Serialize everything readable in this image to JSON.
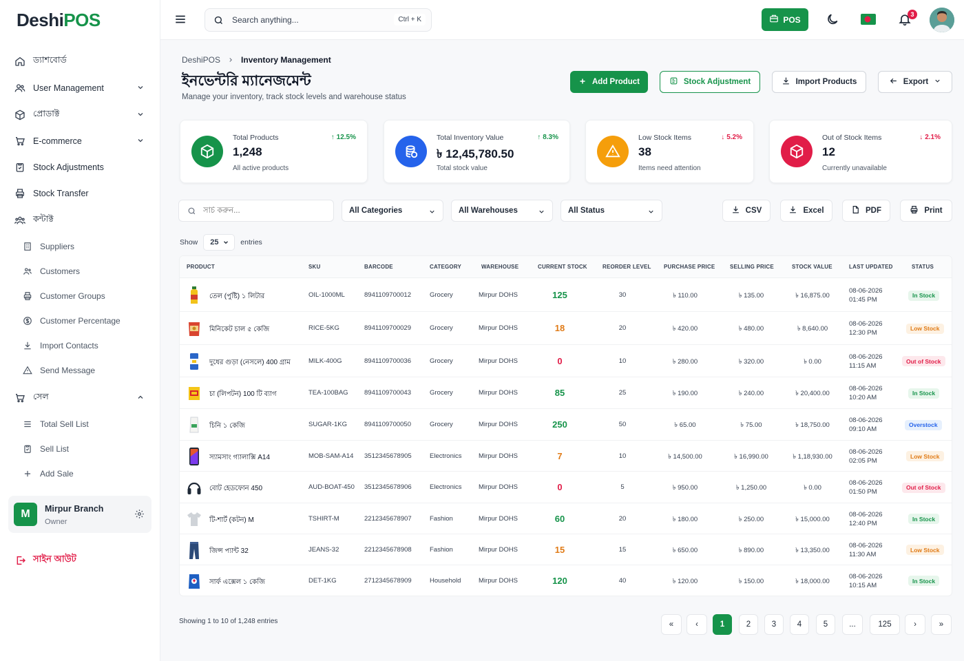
{
  "brand": {
    "prefix": "Deshi",
    "suffix": "POS"
  },
  "sidebar": {
    "items": [
      {
        "label": "ড্যাশবোর্ড",
        "icon": "home-icon"
      },
      {
        "label": "User Management",
        "icon": "users-icon"
      },
      {
        "label": "প্রোডাক্ট",
        "icon": "box-icon"
      },
      {
        "label": "E-commerce",
        "icon": "cart-icon"
      },
      {
        "label": "Stock Adjustments",
        "icon": "clipboard-icon"
      },
      {
        "label": "Stock Transfer",
        "icon": "printer-icon"
      },
      {
        "label": "কন্টাক্ট",
        "icon": "contacts-icon"
      },
      {
        "label": "সেল",
        "icon": "cart-icon"
      }
    ],
    "contact_sub": [
      "Suppliers",
      "Customers",
      "Customer Groups",
      "Customer Percentage",
      "Import Contacts",
      "Send Message"
    ],
    "sale_sub": [
      "Total Sell List",
      "Sell List",
      "Add Sale"
    ],
    "branch": {
      "initial": "M",
      "name": "Mirpur Branch",
      "role": "Owner"
    },
    "signout": "সাইন আউট"
  },
  "header": {
    "search_placeholder": "Search anything...",
    "shortcut": "Ctrl + K",
    "pos_label": "POS",
    "notification_count": "3"
  },
  "breadcrumb": {
    "root": "DeshiPOS",
    "current": "Inventory Management"
  },
  "page": {
    "title": "ইনভেন্টরি ম্যানেজমেন্ট",
    "subtitle": "Manage your inventory, track stock levels and warehouse status"
  },
  "actions": {
    "add": "Add Product",
    "adjust": "Stock Adjustment",
    "import": "Import Products",
    "export": "Export"
  },
  "stats": [
    {
      "label": "Total Products",
      "value": "1,248",
      "note": "All active products",
      "trend": "12.5%",
      "dir": "up",
      "color": "#16934a"
    },
    {
      "label": "Total Inventory Value",
      "value": "৳ 12,45,780.50",
      "note": "Total stock value",
      "trend": "8.3%",
      "dir": "up",
      "color": "#2563eb"
    },
    {
      "label": "Low Stock Items",
      "value": "38",
      "note": "Items need attention",
      "trend": "5.2%",
      "dir": "down",
      "color": "#f59e0b"
    },
    {
      "label": "Out of Stock Items",
      "value": "12",
      "note": "Currently unavailable",
      "trend": "2.1%",
      "dir": "down",
      "color": "#e11d48"
    }
  ],
  "filters": {
    "search_placeholder": "সার্চ করুন...",
    "category": "All Categories",
    "warehouse": "All Warehouses",
    "status": "All Status",
    "csv": "CSV",
    "excel": "Excel",
    "pdf": "PDF",
    "print": "Print"
  },
  "show": {
    "label": "Show",
    "value": "25",
    "suffix": "entries"
  },
  "table": {
    "headers": [
      "PRODUCT",
      "SKU",
      "BARCODE",
      "CATEGORY",
      "WAREHOUSE",
      "CURRENT STOCK",
      "REORDER LEVEL",
      "PURCHASE PRICE",
      "SELLING PRICE",
      "STOCK VALUE",
      "LAST UPDATED",
      "STATUS"
    ],
    "rows": [
      {
        "name": "তেল (পুষ্টি) ১ লিটার",
        "sku": "OIL-1000ML",
        "barcode": "8941109700012",
        "category": "Grocery",
        "warehouse": "Mirpur DOHS",
        "stock": "125",
        "reorder": "30",
        "purchase": "৳ 110.00",
        "selling": "৳ 135.00",
        "value": "৳ 16,875.00",
        "date": "08-06-2026",
        "time": "01:45 PM",
        "status": "In Stock",
        "st": "in",
        "icon": "oil-bottle-icon"
      },
      {
        "name": "মিনিকেট চাল ৫ কেজি",
        "sku": "RICE-5KG",
        "barcode": "8941109700029",
        "category": "Grocery",
        "warehouse": "Mirpur DOHS",
        "stock": "18",
        "reorder": "20",
        "purchase": "৳ 420.00",
        "selling": "৳ 480.00",
        "value": "৳ 8,640.00",
        "date": "08-06-2026",
        "time": "12:30 PM",
        "status": "Low Stock",
        "st": "low",
        "icon": "rice-bag-icon"
      },
      {
        "name": "দুধের গুড়া (নেসলে) 400 গ্রাম",
        "sku": "MILK-400G",
        "barcode": "8941109700036",
        "category": "Grocery",
        "warehouse": "Mirpur DOHS",
        "stock": "0",
        "reorder": "10",
        "purchase": "৳ 280.00",
        "selling": "৳ 320.00",
        "value": "৳ 0.00",
        "date": "08-06-2026",
        "time": "11:15 AM",
        "status": "Out of Stock",
        "st": "out",
        "icon": "milk-can-icon"
      },
      {
        "name": "চা (লিপটন) 100 টি ব্যাগ",
        "sku": "TEA-100BAG",
        "barcode": "8941109700043",
        "category": "Grocery",
        "warehouse": "Mirpur DOHS",
        "stock": "85",
        "reorder": "25",
        "purchase": "৳ 190.00",
        "selling": "৳ 240.00",
        "value": "৳ 20,400.00",
        "date": "08-06-2026",
        "time": "10:20 AM",
        "status": "In Stock",
        "st": "in",
        "icon": "tea-box-icon"
      },
      {
        "name": "চিনি ১ কেজি",
        "sku": "SUGAR-1KG",
        "barcode": "8941109700050",
        "category": "Grocery",
        "warehouse": "Mirpur DOHS",
        "stock": "250",
        "reorder": "50",
        "purchase": "৳ 65.00",
        "selling": "৳ 75.00",
        "value": "৳ 18,750.00",
        "date": "08-06-2026",
        "time": "09:10 AM",
        "status": "Overstock",
        "st": "over",
        "icon": "sugar-pack-icon"
      },
      {
        "name": "স্যামসাং গ্যালাক্সি A14",
        "sku": "MOB-SAM-A14",
        "barcode": "3512345678905",
        "category": "Electronics",
        "warehouse": "Mirpur DOHS",
        "stock": "7",
        "reorder": "10",
        "purchase": "৳ 14,500.00",
        "selling": "৳ 16,990.00",
        "value": "৳ 1,18,930.00",
        "date": "08-06-2026",
        "time": "02:05 PM",
        "status": "Low Stock",
        "st": "low",
        "icon": "phone-icon"
      },
      {
        "name": "বোট হেডফোন 450",
        "sku": "AUD-BOAT-450",
        "barcode": "3512345678906",
        "category": "Electronics",
        "warehouse": "Mirpur DOHS",
        "stock": "0",
        "reorder": "5",
        "purchase": "৳ 950.00",
        "selling": "৳ 1,250.00",
        "value": "৳ 0.00",
        "date": "08-06-2026",
        "time": "01:50 PM",
        "status": "Out of Stock",
        "st": "out",
        "icon": "headphone-icon"
      },
      {
        "name": "টি-শার্ট (কটন) M",
        "sku": "TSHIRT-M",
        "barcode": "2212345678907",
        "category": "Fashion",
        "warehouse": "Mirpur DOHS",
        "stock": "60",
        "reorder": "20",
        "purchase": "৳ 180.00",
        "selling": "৳ 250.00",
        "value": "৳ 15,000.00",
        "date": "08-06-2026",
        "time": "12:40 PM",
        "status": "In Stock",
        "st": "in",
        "icon": "tshirt-icon"
      },
      {
        "name": "জিন্স প্যান্ট 32",
        "sku": "JEANS-32",
        "barcode": "2212345678908",
        "category": "Fashion",
        "warehouse": "Mirpur DOHS",
        "stock": "15",
        "reorder": "15",
        "purchase": "৳ 650.00",
        "selling": "৳ 890.00",
        "value": "৳ 13,350.00",
        "date": "08-06-2026",
        "time": "11:30 AM",
        "status": "Low Stock",
        "st": "low",
        "icon": "jeans-icon"
      },
      {
        "name": "সার্ফ এক্সেল ১ কেজি",
        "sku": "DET-1KG",
        "barcode": "2712345678909",
        "category": "Household",
        "warehouse": "Mirpur DOHS",
        "stock": "120",
        "reorder": "40",
        "purchase": "৳ 120.00",
        "selling": "৳ 150.00",
        "value": "৳ 18,000.00",
        "date": "08-06-2026",
        "time": "10:15 AM",
        "status": "In Stock",
        "st": "in",
        "icon": "detergent-icon"
      }
    ]
  },
  "footer": {
    "showing": "Showing 1 to 10 of 1,248 entries",
    "pages": [
      "«",
      "‹",
      "1",
      "2",
      "3",
      "4",
      "5",
      "...",
      "125",
      "›",
      "»"
    ]
  }
}
